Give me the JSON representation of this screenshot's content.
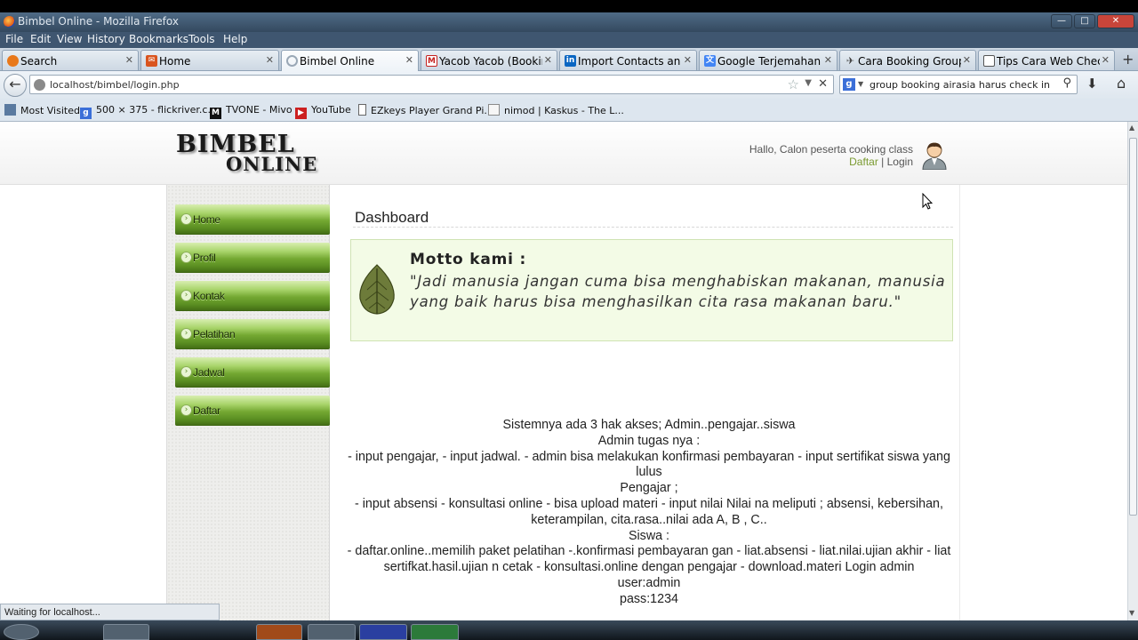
{
  "window": {
    "title": "Bimbel Online - Mozilla Firefox"
  },
  "menubar": [
    "File",
    "Edit",
    "View",
    "History",
    "Bookmarks",
    "Tools",
    "Help"
  ],
  "tabs": [
    {
      "label": "Search",
      "icon": "firefox-search-icon",
      "color": "#e8781a"
    },
    {
      "label": "Home",
      "icon": "mail-icon",
      "color": "#d9541e"
    },
    {
      "label": "Bimbel Online",
      "icon": "loading-icon",
      "color": "#9aa8b6"
    },
    {
      "label": "Yacob Yacob (Bookin...",
      "icon": "gmail-icon",
      "color": "#c5221f"
    },
    {
      "label": "Import Contacts and I...",
      "icon": "linkedin-icon",
      "color": "#0a66c2"
    },
    {
      "label": "Google Terjemahan",
      "icon": "translate-icon",
      "color": "#4285f4"
    },
    {
      "label": "Cara Booking Group ...",
      "icon": "plane-icon",
      "color": "#444444"
    },
    {
      "label": "Tips Cara Web Check ...",
      "icon": "blog-icon",
      "color": "#555555"
    }
  ],
  "navbar": {
    "url": "localhost/bimbel/login.php",
    "search_query": "group booking airasia harus check in"
  },
  "bookmarks": [
    {
      "label": "Most Visited",
      "color": "#5a7aa0"
    },
    {
      "label": "500 × 375 - flickriver.c...",
      "color": "#3b6fd8"
    },
    {
      "label": "TVONE - Mivo",
      "color": "#111111"
    },
    {
      "label": "YouTube",
      "color": "#cc2020"
    },
    {
      "label": "EZkeys Player Grand Pi...",
      "color": "#666666"
    },
    {
      "label": "nimod | Kaskus - The L...",
      "color": "#8a8a8a"
    }
  ],
  "site": {
    "logo_line1": "BIMBEL",
    "logo_line2": "ONLINE",
    "greeting": "Hallo, Calon peserta cooking class",
    "register_link": "Daftar",
    "separator": " | ",
    "login_link": "Login"
  },
  "sidebar": {
    "items": [
      {
        "label": "Home"
      },
      {
        "label": "Profil"
      },
      {
        "label": "Kontak"
      },
      {
        "label": "Pelatihan"
      },
      {
        "label": "Jadwal"
      },
      {
        "label": "Daftar"
      }
    ]
  },
  "main": {
    "title": "Dashboard",
    "motto_heading": "Motto kami :",
    "motto_quote": "\"Jadi manusia jangan cuma bisa menghabiskan makanan, manusia yang baik harus bisa menghasilkan cita rasa makanan baru.\"",
    "description_lines": [
      "Sistemnya ada 3 hak akses; Admin..pengajar..siswa",
      "Admin tugas nya :",
      "- input pengajar, - input jadwal. - admin bisa melakukan konfirmasi pembayaran - input sertifikat siswa yang lulus",
      "Pengajar ;",
      "- input absensi - konsultasi online - bisa upload materi - input nilai Nilai na meliputi ; absensi, kebersihan, keterampilan, cita.rasa..nilai ada A, B , C..",
      "Siswa :",
      "- daftar.online..memilih paket pelatihan -.konfirmasi pembayaran gan - liat.absensi - liat.nilai.ujian akhir - liat sertifkat.hasil.ujian n cetak - konsultasi.online dengan pengajar - download.materi Login admin",
      "user:admin",
      "pass:1234"
    ]
  },
  "status": {
    "text": "Waiting for localhost..."
  },
  "colors": {
    "nav_green": "#74a832",
    "motto_bg": "#f3fbe6",
    "link_green": "#7a9a30"
  }
}
